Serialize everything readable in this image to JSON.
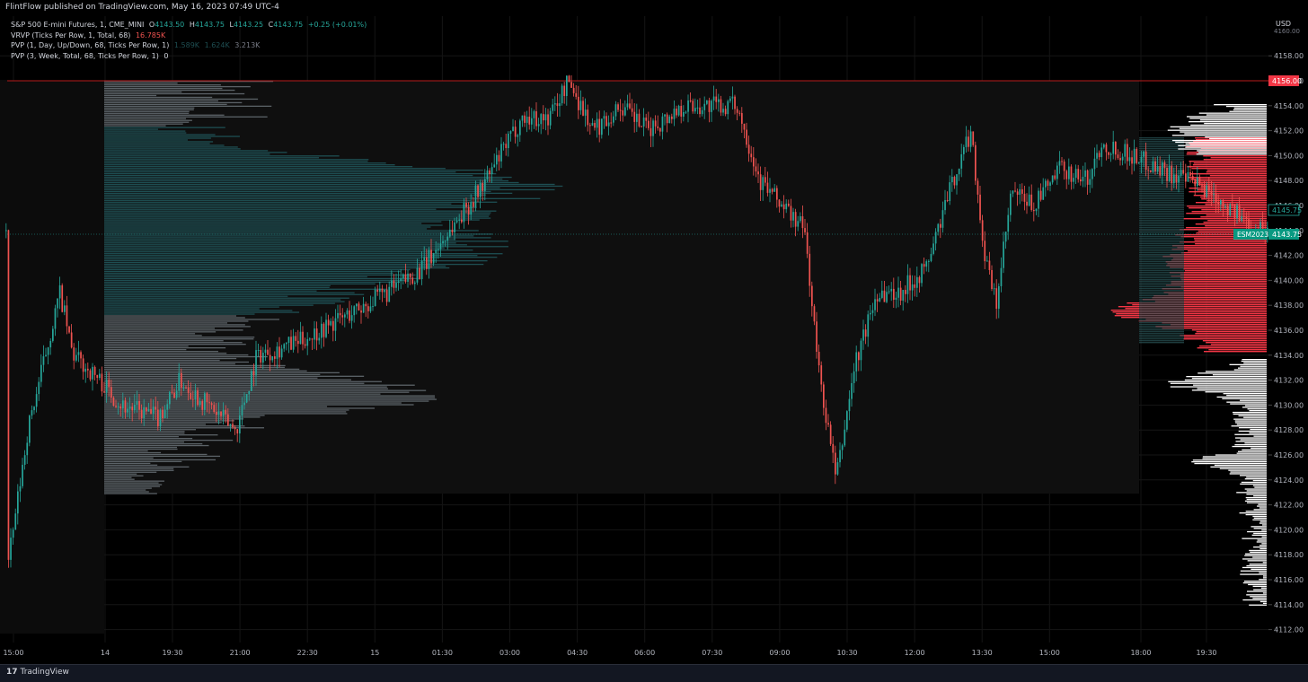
{
  "header": {
    "published": "FlintFlow published on TradingView.com, May 16, 2023 07:49 UTC-4"
  },
  "legend": {
    "symbol": "S&P 500 E-mini Futures, 1, CME_MINI",
    "o_label": "O",
    "o": "4143.50",
    "h_label": "H",
    "h": "4143.75",
    "l_label": "L",
    "l": "4143.25",
    "c_label": "C",
    "c": "4143.75",
    "change": "+0.25 (+0.01%)",
    "vrvp": "VRVP (Ticks Per Row, 1, Total, 68)",
    "vrvp_value": "16.785K",
    "pvp1": "PVP (1, Day, Up/Down, 68, Ticks Per Row, 1)",
    "pvp1_v1": "1.589K",
    "pvp1_v2": "1.624K",
    "pvp1_v3": "3.213K",
    "pvp2": "PVP (3, Week, Total, 68, Ticks Per Row, 1)",
    "pvp2_value": "0"
  },
  "price_axis": {
    "currency": "USD",
    "top_tick": "4160.00",
    "ticks": [
      "4158.00",
      "4156.00",
      "4154.00",
      "4152.00",
      "4150.00",
      "4148.00",
      "4146.00",
      "4144.00",
      "4142.00",
      "4140.00",
      "4138.00",
      "4136.00",
      "4134.00",
      "4132.00",
      "4130.00",
      "4128.00",
      "4126.00",
      "4124.00",
      "4122.00",
      "4120.00",
      "4118.00",
      "4116.00",
      "4114.00",
      "4112.00"
    ],
    "range": [
      4111,
      4161
    ],
    "high_marker": "4156.00",
    "vwap_marker": "4145.75",
    "symbol_tag": "ESM2023",
    "last_price": "4143.75"
  },
  "time_axis": {
    "labels": [
      "15:00",
      "14",
      "19:30",
      "21:00",
      "22:30",
      "15",
      "01:30",
      "03:00",
      "04:30",
      "06:00",
      "07:30",
      "09:00",
      "10:30",
      "12:00",
      "13:30",
      "15:00",
      "18:00",
      "19:30"
    ]
  },
  "colors": {
    "up": "#26a69a",
    "down": "#ef5350",
    "vp_teal": "#1e4e52",
    "vp_gray": "#5b6267",
    "pvp_red": "#f23645",
    "pvp_white": "#ffffff",
    "high_line": "#b71c1c",
    "last_tag": "#089981"
  },
  "branding": {
    "tv_mark": "17",
    "tv_name": "TradingView"
  }
}
